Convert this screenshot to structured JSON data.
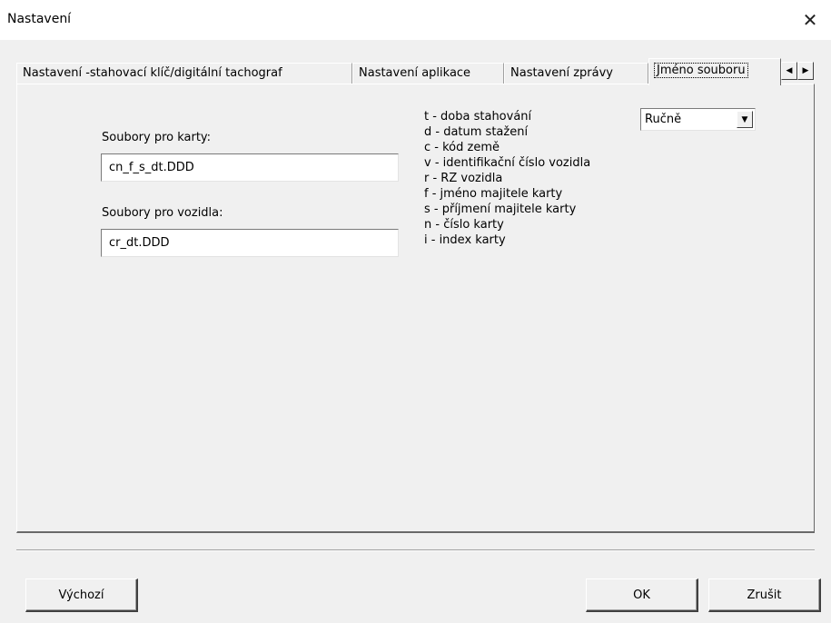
{
  "window": {
    "title": "Nastavení",
    "close_symbol": "✕"
  },
  "tabs": [
    {
      "label": "Nastavení -stahovací klíč/digitální tachograf"
    },
    {
      "label": "Nastavení aplikace"
    },
    {
      "label": "Nastavení zprávy"
    },
    {
      "label": "Jméno souboru"
    }
  ],
  "tab_scroll": {
    "left_icon": "◀",
    "right_icon": "▶"
  },
  "form": {
    "cards_label": "Soubory pro karty:",
    "cards_value": "cn_f_s_dt.DDD",
    "vehicles_label": "Soubory pro vozidla:",
    "vehicles_value": "cr_dt.DDD"
  },
  "legend": [
    "t - doba stahování",
    "d - datum stažení",
    "c - kód země",
    "v - identifikační číslo vozidla",
    "r - RZ vozidla",
    "f - jméno majitele karty",
    "s - příjmení majitele karty",
    "n - číslo karty",
    "i - index karty"
  ],
  "mode_select": {
    "value": "Ručně",
    "arrow": "▼"
  },
  "buttons": {
    "default": "Výchozí",
    "ok": "OK",
    "cancel": "Zrušit"
  }
}
